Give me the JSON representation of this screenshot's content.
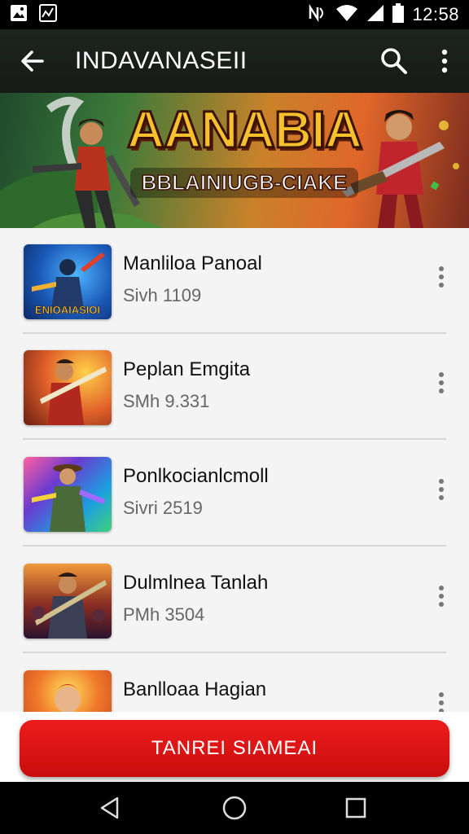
{
  "status_bar": {
    "time": "12:58",
    "icons": [
      "gallery-notification-icon",
      "chart-notification-icon",
      "nfc-icon",
      "wifi-icon",
      "signal-icon",
      "battery-icon"
    ]
  },
  "app_bar": {
    "title": "INDAVANASEII",
    "back_icon": "arrow-back-icon",
    "search_icon": "search-icon",
    "more_icon": "more-vert-icon"
  },
  "banner": {
    "title": "AANABIA",
    "subtitle": "BBLAINIUGB-CIAKE"
  },
  "games": [
    {
      "title": "Manliloa Panoal",
      "subtitle": "Sivh 1109",
      "thumb_caption": "ENIOAIASIOI",
      "accent": "#1a57b5"
    },
    {
      "title": "Peplan Emgita",
      "subtitle": "SMh 9.331",
      "thumb_caption": "",
      "accent": "#d2491e"
    },
    {
      "title": "Ponlkocianlcmoll",
      "subtitle": "Sivri 2519",
      "thumb_caption": "",
      "accent": "#2a80d0"
    },
    {
      "title": "Dulmlnea Tanlah",
      "subtitle": "PMh 3504",
      "thumb_caption": "",
      "accent": "#8a2c22"
    },
    {
      "title": "Banlloaa Hagian",
      "subtitle": "",
      "thumb_caption": "",
      "accent": "#c2391f"
    }
  ],
  "cta": {
    "label": "TANREI SIAMEAI",
    "color": "#e01414"
  },
  "nav_bar": {
    "back": "nav-back-icon",
    "home": "nav-home-icon",
    "recents": "nav-recents-icon"
  }
}
